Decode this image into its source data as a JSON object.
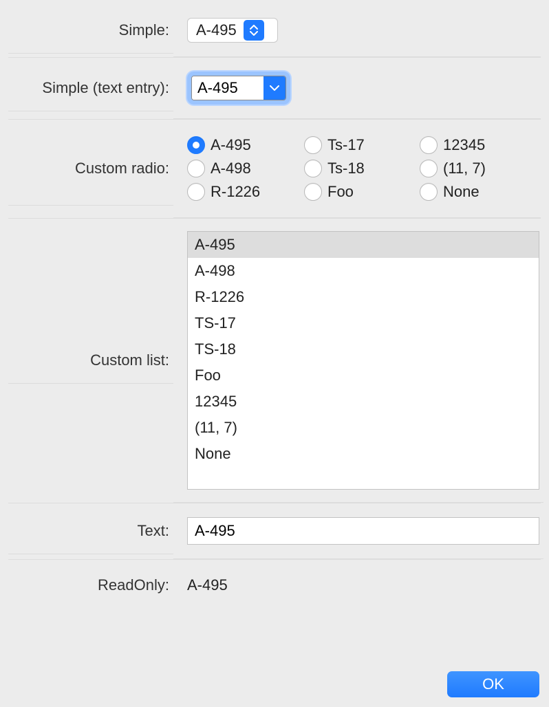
{
  "labels": {
    "simple": "Simple:",
    "simple_text_entry": "Simple (text entry):",
    "custom_radio": "Custom radio:",
    "custom_list": "Custom list:",
    "text": "Text:",
    "readonly": "ReadOnly:"
  },
  "simple_popup": {
    "value": "A-495"
  },
  "simple_combo": {
    "value": "A-495"
  },
  "radio": {
    "options": [
      "A-495",
      "Ts-17",
      "12345",
      "A-498",
      "Ts-18",
      "(11, 7)",
      "R-1226",
      "Foo",
      "None"
    ],
    "selected_index": 0
  },
  "list": {
    "items": [
      "A-495",
      "A-498",
      "R-1226",
      "TS-17",
      "TS-18",
      "Foo",
      "12345",
      "(11, 7)",
      "None"
    ],
    "selected_index": 0
  },
  "text_input": {
    "value": "A-495"
  },
  "readonly_value": "A-495",
  "ok_button": "OK"
}
